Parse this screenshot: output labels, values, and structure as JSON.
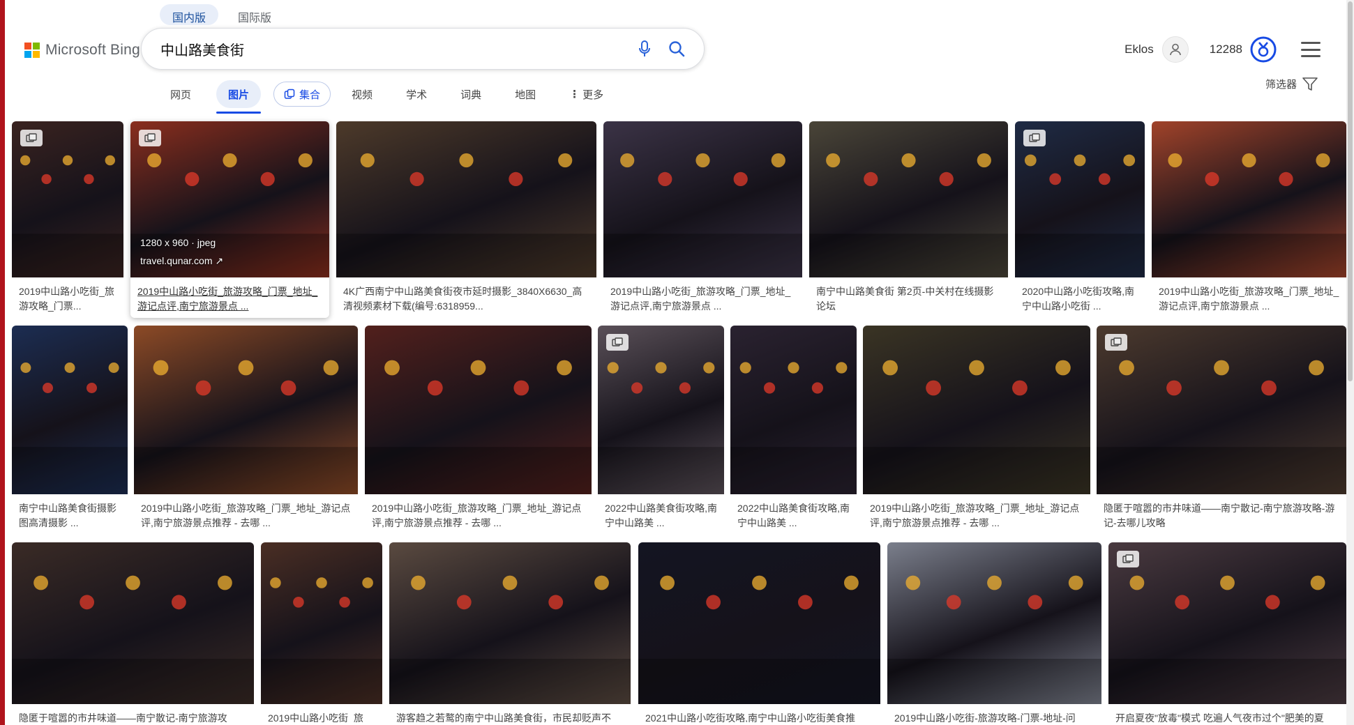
{
  "version_tabs": [
    "国内版",
    "国际版"
  ],
  "logo": {
    "text": "Microsoft Bing",
    "colors": [
      "#f25022",
      "#7fba00",
      "#00a4ef",
      "#ffb900"
    ]
  },
  "search": {
    "query": "中山路美食街"
  },
  "header": {
    "user_name": "Eklos",
    "points": "12288"
  },
  "nav": {
    "items": [
      "网页",
      "图片",
      "集合",
      "视频",
      "学术",
      "词典",
      "地图",
      "更多"
    ],
    "filter_label": "筛选器"
  },
  "hover_info": {
    "size": "1280 x 960 · jpeg",
    "domain": "travel.qunar.com"
  },
  "results": [
    {
      "caption": "2019中山路小吃街_旅游攻略_门票...",
      "gallery": true,
      "bg": "#3a2320"
    },
    {
      "caption": "2019中山路小吃街_旅游攻略_门票_地址_游记点评,南宁旅游景点 ...",
      "gallery": true,
      "bg": "#8a2e1e"
    },
    {
      "caption": "4K广西南宁中山路美食街夜市延时摄影_3840X6630_高清视频素材下载(编号:6318959...",
      "gallery": false,
      "bg": "#4d3a2a"
    },
    {
      "caption": "2019中山路小吃街_旅游攻略_门票_地址_游记点评,南宁旅游景点 ...",
      "gallery": false,
      "bg": "#3b3346"
    },
    {
      "caption": "南宁中山路美食街 第2页-中关村在线摄影论坛",
      "gallery": false,
      "bg": "#4a4538"
    },
    {
      "caption": "2020中山路小吃街攻略,南宁中山路小吃街 ...",
      "gallery": true,
      "bg": "#1f2b45"
    },
    {
      "caption": "2019中山路小吃街_旅游攻略_门票_地址_游记点评,南宁旅游景点 ...",
      "gallery": false,
      "bg": "#a1432a"
    },
    {
      "caption": "南宁中山路美食街摄影图高清摄影 ...",
      "gallery": false,
      "bg": "#1c2d52"
    },
    {
      "caption": "2019中山路小吃街_旅游攻略_门票_地址_游记点评,南宁旅游景点推荐 - 去哪 ...",
      "gallery": false,
      "bg": "#8c4a26"
    },
    {
      "caption": "2019中山路小吃街_旅游攻略_门票_地址_游记点评,南宁旅游景点推荐 - 去哪 ...",
      "gallery": false,
      "bg": "#52201c"
    },
    {
      "caption": "2022中山路美食街攻略,南宁中山路美 ...",
      "gallery": true,
      "bg": "#5a5058"
    },
    {
      "caption": "2022中山路美食街攻略,南宁中山路美 ...",
      "gallery": false,
      "bg": "#2a2230"
    },
    {
      "caption": "2019中山路小吃街_旅游攻略_门票_地址_游记点评,南宁旅游景点推荐 - 去哪 ...",
      "gallery": false,
      "bg": "#3a3424"
    },
    {
      "caption": "隐匿于喧嚣的市井味道——南宁散记-南宁旅游攻略-游记-去哪儿攻略",
      "gallery": true,
      "bg": "#4c3a2e"
    },
    {
      "caption": "隐匿于喧嚣的市井味道——南宁散记-南宁旅游攻",
      "gallery": false,
      "bg": "#3a2b26"
    },
    {
      "caption": "2019中山路小吃街_旅",
      "gallery": false,
      "bg": "#4a2e24"
    },
    {
      "caption": "游客趋之若鹜的南宁中山路美食街，市民却贬声不",
      "gallery": false,
      "bg": "#5a4a40"
    },
    {
      "caption": "2021中山路小吃街攻略,南宁中山路小吃街美食推",
      "gallery": false,
      "bg": "#141522"
    },
    {
      "caption": "2019中山路小吃街-旅游攻略-门票-地址-问",
      "gallery": false,
      "bg": "#7b7f8c"
    },
    {
      "caption": "开启夏夜\"放毒\"模式 吃遍人气夜市过个\"肥美的夏",
      "gallery": true,
      "bg": "#4a3a40"
    }
  ]
}
